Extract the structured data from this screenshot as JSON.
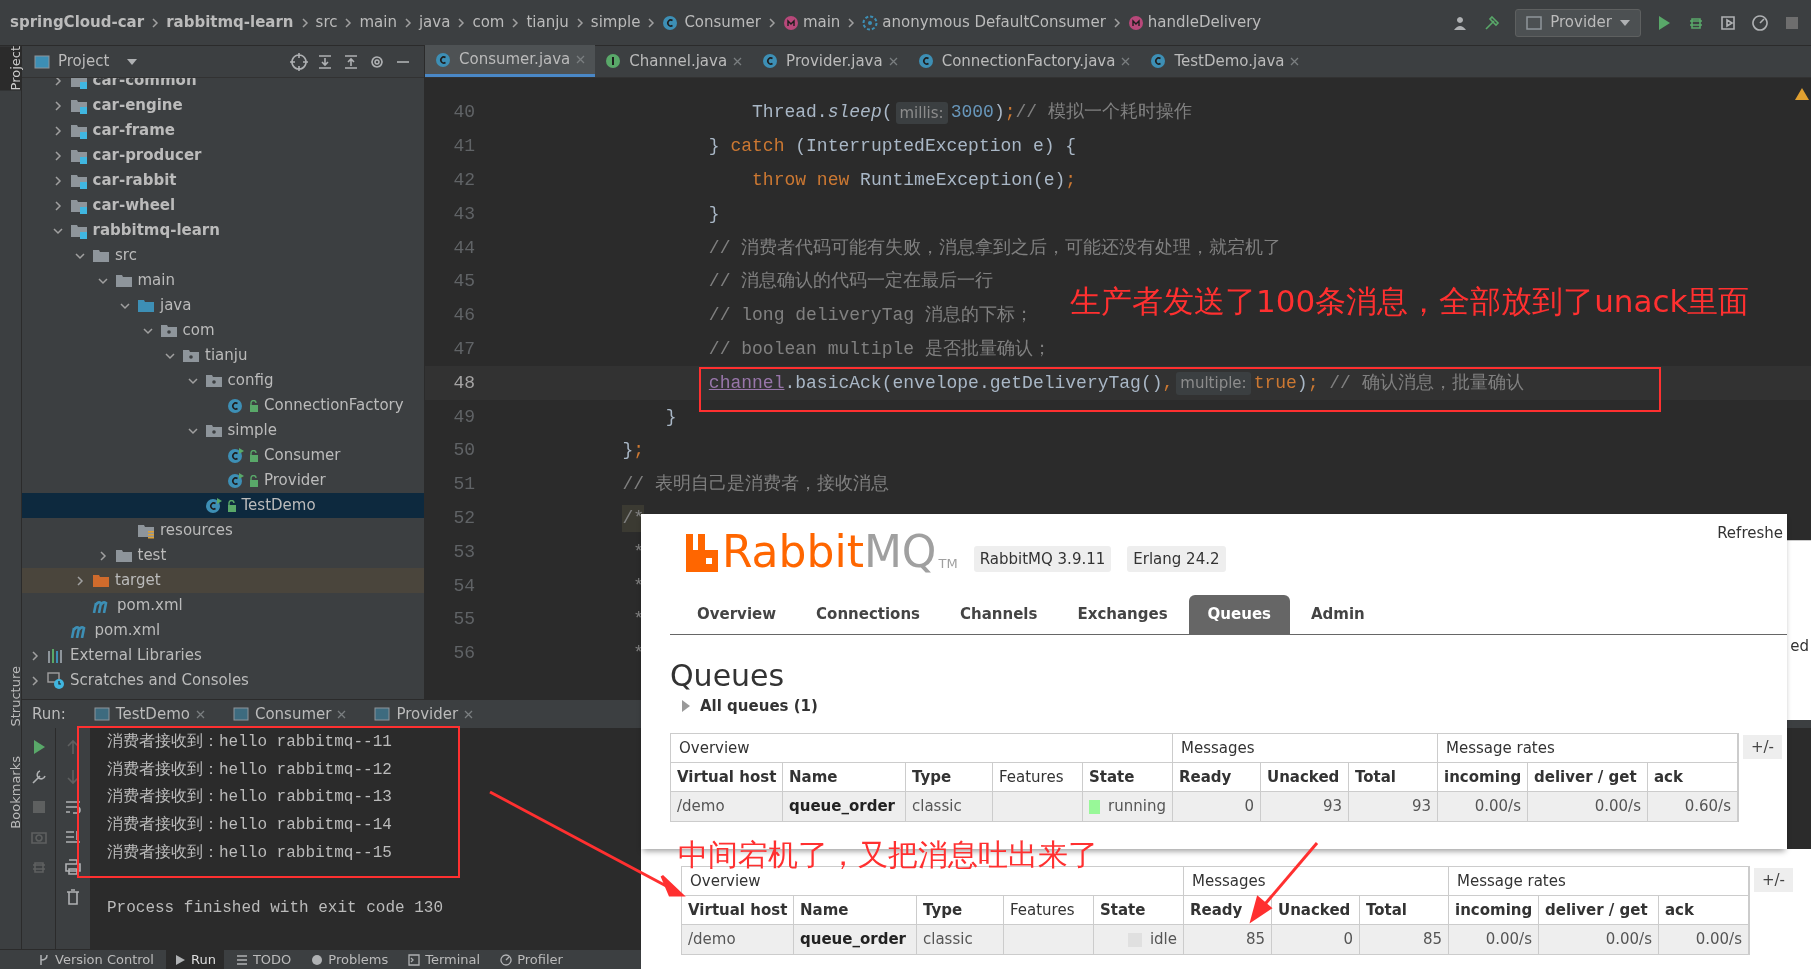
{
  "breadcrumbs": [
    {
      "label": "springCloud-car",
      "kind": "module"
    },
    {
      "label": "rabbitmq-learn",
      "kind": "module"
    },
    {
      "label": "src",
      "kind": "folder"
    },
    {
      "label": "main",
      "kind": "folder"
    },
    {
      "label": "java",
      "kind": "folder"
    },
    {
      "label": "com",
      "kind": "folder"
    },
    {
      "label": "tianju",
      "kind": "folder"
    },
    {
      "label": "simple",
      "kind": "folder"
    },
    {
      "label": "Consumer",
      "kind": "class"
    },
    {
      "label": "main",
      "kind": "method"
    },
    {
      "label": "anonymous DefaultConsumer",
      "kind": "anonymous"
    },
    {
      "label": "handleDelivery",
      "kind": "method"
    }
  ],
  "run_configuration": "Provider",
  "left_stripe": {
    "top": [
      {
        "label": "Project",
        "selected": true
      }
    ],
    "bottom": [
      {
        "label": "Structure",
        "selected": false
      },
      {
        "label": "Bookmarks",
        "selected": false
      }
    ]
  },
  "project_panel": {
    "title": "Project",
    "module_items": [
      {
        "label": "car-common",
        "kind": "module",
        "expanded": false
      },
      {
        "label": "car-engine",
        "kind": "module",
        "expanded": false
      },
      {
        "label": "car-frame",
        "kind": "module",
        "expanded": false
      },
      {
        "label": "car-producer",
        "kind": "module",
        "expanded": false
      },
      {
        "label": "car-rabbit",
        "kind": "module",
        "expanded": false
      },
      {
        "label": "car-wheel",
        "kind": "module",
        "expanded": false
      },
      {
        "label": "rabbitmq-learn",
        "kind": "module",
        "expanded": true,
        "children": [
          {
            "label": "src",
            "kind": "folder",
            "expanded": true,
            "children": [
              {
                "label": "main",
                "kind": "folder",
                "expanded": true,
                "children": [
                  {
                    "label": "java",
                    "kind": "source",
                    "expanded": true,
                    "children": [
                      {
                        "label": "com",
                        "kind": "package",
                        "expanded": true,
                        "children": [
                          {
                            "label": "tianju",
                            "kind": "package",
                            "expanded": true,
                            "children": [
                              {
                                "label": "config",
                                "kind": "package",
                                "expanded": true,
                                "children": [
                                  {
                                    "label": "ConnectionFactory",
                                    "kind": "class",
                                    "selected": false
                                  }
                                ]
                              },
                              {
                                "label": "simple",
                                "kind": "package",
                                "expanded": true,
                                "children": [
                                  {
                                    "label": "Consumer",
                                    "kind": "runnable",
                                    "selected": false
                                  },
                                  {
                                    "label": "Provider",
                                    "kind": "runnable",
                                    "selected": false
                                  }
                                ]
                              },
                              {
                                "label": "TestDemo",
                                "kind": "runnable",
                                "selected": true
                              }
                            ]
                          }
                        ]
                      }
                    ]
                  },
                  {
                    "label": "resources",
                    "kind": "resources"
                  }
                ]
              },
              {
                "label": "test",
                "kind": "folder",
                "expanded": false
              }
            ]
          },
          {
            "label": "target",
            "kind": "excluded",
            "expanded": false
          },
          {
            "label": "pom.xml",
            "kind": "maven"
          }
        ]
      },
      {
        "label": "pom.xml",
        "kind": "maven"
      }
    ],
    "library_items": [
      {
        "label": "External Libraries",
        "kind": "libraries",
        "expanded": false
      },
      {
        "label": "Scratches and Consoles",
        "kind": "scratches",
        "expanded": false
      }
    ]
  },
  "editor_tabs": [
    {
      "label": "Consumer.java",
      "kind": "class",
      "selected": true
    },
    {
      "label": "Channel.java",
      "kind": "interface",
      "selected": false
    },
    {
      "label": "Provider.java",
      "kind": "class",
      "selected": false
    },
    {
      "label": "ConnectionFactory.java",
      "kind": "class",
      "selected": false
    },
    {
      "label": "TestDemo.java",
      "kind": "class",
      "selected": false
    }
  ],
  "code_lines": [
    {
      "number": "40",
      "current": false,
      "tokens": [
        {
          "text": "                    Thread.",
          "kind": "plain"
        },
        {
          "text": "sleep",
          "kind": "italic"
        },
        {
          "text": "(",
          "kind": "plain"
        },
        {
          "text": "millis:",
          "kind": "hint"
        },
        {
          "text": "3000",
          "kind": "number"
        },
        {
          "text": ")",
          "kind": "plain"
        },
        {
          "text": ";",
          "kind": "keyword"
        },
        {
          "text": "// 模拟一个耗时操作",
          "kind": "comment"
        }
      ]
    },
    {
      "number": "41",
      "current": false,
      "tokens": [
        {
          "text": "                } ",
          "kind": "plain"
        },
        {
          "text": "catch",
          "kind": "keyword"
        },
        {
          "text": " (InterruptedException e) {",
          "kind": "plain"
        }
      ]
    },
    {
      "number": "42",
      "current": false,
      "tokens": [
        {
          "text": "                    throw new",
          "kind": "keyword"
        },
        {
          "text": " RuntimeException(e)",
          "kind": "plain"
        },
        {
          "text": ";",
          "kind": "keyword"
        }
      ]
    },
    {
      "number": "43",
      "current": false,
      "tokens": [
        {
          "text": "                }",
          "kind": "plain"
        }
      ]
    },
    {
      "number": "44",
      "current": false,
      "tokens": [
        {
          "text": "                // 消费者代码可能有失败，消息拿到之后，可能还没有处理，就宕机了",
          "kind": "comment"
        }
      ]
    },
    {
      "number": "45",
      "current": false,
      "tokens": [
        {
          "text": "                // 消息确认的代码一定在最后一行",
          "kind": "comment"
        }
      ]
    },
    {
      "number": "46",
      "current": false,
      "tokens": [
        {
          "text": "                // long deliveryTag 消息的下标；",
          "kind": "comment"
        }
      ]
    },
    {
      "number": "47",
      "current": false,
      "tokens": [
        {
          "text": "                // boolean multiple 是否批量确认；",
          "kind": "comment"
        }
      ]
    },
    {
      "number": "48",
      "current": true,
      "tokens": [
        {
          "text": "                channel",
          "kind": "field"
        },
        {
          "text": ".basicAck(envelope.getDeliveryTag()",
          "kind": "plain"
        },
        {
          "text": ",",
          "kind": "keyword"
        },
        {
          "text": "multiple:",
          "kind": "hint"
        },
        {
          "text": "true",
          "kind": "keyword"
        },
        {
          "text": ")",
          "kind": "plain"
        },
        {
          "text": ";",
          "kind": "keyword"
        },
        {
          "text": " // 确认消息，批量确认",
          "kind": "comment"
        }
      ]
    },
    {
      "number": "49",
      "current": false,
      "tokens": [
        {
          "text": "            }",
          "kind": "plain"
        }
      ]
    },
    {
      "number": "50",
      "current": false,
      "tokens": [
        {
          "text": "        }",
          "kind": "plain"
        },
        {
          "text": ";",
          "kind": "keyword"
        }
      ]
    },
    {
      "number": "51",
      "current": false,
      "tokens": [
        {
          "text": "        // 表明自己是消费者，接收消息",
          "kind": "comment"
        }
      ]
    },
    {
      "number": "52",
      "current": false,
      "tokens": [
        {
          "text": "        /*",
          "kind": "matched"
        }
      ]
    },
    {
      "number": "53",
      "current": false,
      "tokens": [
        {
          "text": "         *",
          "kind": "comment"
        }
      ]
    },
    {
      "number": "54",
      "current": false,
      "tokens": [
        {
          "text": "         *",
          "kind": "comment"
        }
      ]
    },
    {
      "number": "55",
      "current": false,
      "tokens": [
        {
          "text": "         *",
          "kind": "comment"
        }
      ]
    },
    {
      "number": "56",
      "current": false,
      "tokens": [
        {
          "text": "         *",
          "kind": "comment"
        }
      ]
    }
  ],
  "run_panel": {
    "label": "Run:",
    "tabs": [
      {
        "label": "TestDemo"
      },
      {
        "label": "Consumer"
      },
      {
        "label": "Provider"
      }
    ],
    "output": [
      "消费者接收到：hello rabbitmq--11",
      "消费者接收到：hello rabbitmq--12",
      "消费者接收到：hello rabbitmq--13",
      "消费者接收到：hello rabbitmq--14",
      "消费者接收到：hello rabbitmq--15"
    ],
    "exit_line": "Process finished with exit code 130"
  },
  "bottom_bar": [
    {
      "label": "Version Control",
      "kind": "vcs",
      "selected": false
    },
    {
      "label": "Run",
      "kind": "run",
      "selected": true
    },
    {
      "label": "TODO",
      "kind": "todo",
      "selected": false
    },
    {
      "label": "Problems",
      "kind": "problems",
      "selected": false
    },
    {
      "label": "Terminal",
      "kind": "terminal",
      "selected": false
    },
    {
      "label": "Profiler",
      "kind": "profiler",
      "selected": false
    }
  ],
  "rabbitmq_window": {
    "logo": {
      "primary": "Rabbit",
      "secondary": "MQ",
      "mark": "TM"
    },
    "versions": [
      "RabbitMQ 3.9.11",
      "Erlang 24.2"
    ],
    "refresh_text": "Refreshe",
    "nav": [
      {
        "label": "Overview",
        "selected": false
      },
      {
        "label": "Connections",
        "selected": false
      },
      {
        "label": "Channels",
        "selected": false
      },
      {
        "label": "Exchanges",
        "selected": false
      },
      {
        "label": "Queues",
        "selected": true
      },
      {
        "label": "Admin",
        "selected": false
      }
    ],
    "heading": "Queues",
    "section": "All queues (1)",
    "table": {
      "groups": [
        {
          "label": "Overview",
          "columns": [
            "Virtual host",
            "Name",
            "Type",
            "Features",
            "State"
          ]
        },
        {
          "label": "Messages",
          "columns": [
            "Ready",
            "Unacked",
            "Total"
          ]
        },
        {
          "label": "Message rates",
          "columns": [
            "incoming",
            "deliver / get",
            "ack"
          ]
        }
      ],
      "toggle": "+/-",
      "rows": [
        {
          "cells": [
            {
              "text": "/demo",
              "kind": "text"
            },
            {
              "text": "queue_order",
              "kind": "bold"
            },
            {
              "text": "classic",
              "kind": "text"
            },
            {
              "kind": "empty"
            },
            {
              "text": "running",
              "kind": "state",
              "color": "#98f898"
            },
            {
              "text": "0",
              "kind": "number"
            },
            {
              "text": "93",
              "kind": "number"
            },
            {
              "text": "93",
              "kind": "number"
            },
            {
              "text": "0.00/s",
              "kind": "number"
            },
            {
              "text": "0.00/s",
              "kind": "number"
            },
            {
              "text": "0.60/s",
              "kind": "number"
            }
          ]
        }
      ]
    }
  },
  "rabbitmq_window_later": {
    "table": {
      "groups": [
        {
          "label": "Overview",
          "columns": [
            "Virtual host",
            "Name",
            "Type",
            "Features",
            "State"
          ]
        },
        {
          "label": "Messages",
          "columns": [
            "Ready",
            "Unacked",
            "Total"
          ]
        },
        {
          "label": "Message rates",
          "columns": [
            "incoming",
            "deliver / get",
            "ack"
          ]
        }
      ],
      "toggle": "+/-",
      "rows": [
        {
          "cells": [
            {
              "text": "/demo",
              "kind": "text"
            },
            {
              "text": "queue_order",
              "kind": "bold"
            },
            {
              "text": "classic",
              "kind": "text"
            },
            {
              "kind": "empty"
            },
            {
              "text": "idle",
              "kind": "state",
              "color": "#e0e0e0"
            },
            {
              "text": "85",
              "kind": "number"
            },
            {
              "text": "0",
              "kind": "number"
            },
            {
              "text": "85",
              "kind": "number"
            },
            {
              "text": "0.00/s",
              "kind": "number"
            },
            {
              "text": "0.00/s",
              "kind": "number"
            },
            {
              "text": "0.00/s",
              "kind": "number"
            }
          ]
        }
      ]
    }
  },
  "background_window_text": "ed",
  "annotations": [
    {
      "text": "生产者发送了100条消息，全部放到了unack里面"
    },
    {
      "text": "中间宕机了，又把消息吐出来了"
    }
  ]
}
